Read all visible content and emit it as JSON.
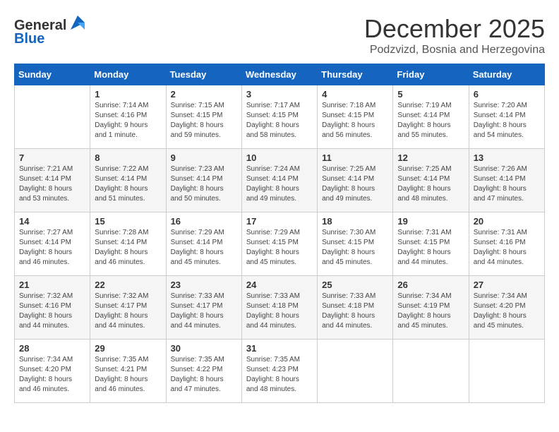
{
  "logo": {
    "general": "General",
    "blue": "Blue"
  },
  "header": {
    "month": "December 2025",
    "location": "Podzvizd, Bosnia and Herzegovina"
  },
  "weekdays": [
    "Sunday",
    "Monday",
    "Tuesday",
    "Wednesday",
    "Thursday",
    "Friday",
    "Saturday"
  ],
  "weeks": [
    [
      {
        "day": "",
        "info": ""
      },
      {
        "day": "1",
        "info": "Sunrise: 7:14 AM\nSunset: 4:16 PM\nDaylight: 9 hours\nand 1 minute."
      },
      {
        "day": "2",
        "info": "Sunrise: 7:15 AM\nSunset: 4:15 PM\nDaylight: 8 hours\nand 59 minutes."
      },
      {
        "day": "3",
        "info": "Sunrise: 7:17 AM\nSunset: 4:15 PM\nDaylight: 8 hours\nand 58 minutes."
      },
      {
        "day": "4",
        "info": "Sunrise: 7:18 AM\nSunset: 4:15 PM\nDaylight: 8 hours\nand 56 minutes."
      },
      {
        "day": "5",
        "info": "Sunrise: 7:19 AM\nSunset: 4:14 PM\nDaylight: 8 hours\nand 55 minutes."
      },
      {
        "day": "6",
        "info": "Sunrise: 7:20 AM\nSunset: 4:14 PM\nDaylight: 8 hours\nand 54 minutes."
      }
    ],
    [
      {
        "day": "7",
        "info": "Sunrise: 7:21 AM\nSunset: 4:14 PM\nDaylight: 8 hours\nand 53 minutes."
      },
      {
        "day": "8",
        "info": "Sunrise: 7:22 AM\nSunset: 4:14 PM\nDaylight: 8 hours\nand 51 minutes."
      },
      {
        "day": "9",
        "info": "Sunrise: 7:23 AM\nSunset: 4:14 PM\nDaylight: 8 hours\nand 50 minutes."
      },
      {
        "day": "10",
        "info": "Sunrise: 7:24 AM\nSunset: 4:14 PM\nDaylight: 8 hours\nand 49 minutes."
      },
      {
        "day": "11",
        "info": "Sunrise: 7:25 AM\nSunset: 4:14 PM\nDaylight: 8 hours\nand 49 minutes."
      },
      {
        "day": "12",
        "info": "Sunrise: 7:25 AM\nSunset: 4:14 PM\nDaylight: 8 hours\nand 48 minutes."
      },
      {
        "day": "13",
        "info": "Sunrise: 7:26 AM\nSunset: 4:14 PM\nDaylight: 8 hours\nand 47 minutes."
      }
    ],
    [
      {
        "day": "14",
        "info": "Sunrise: 7:27 AM\nSunset: 4:14 PM\nDaylight: 8 hours\nand 46 minutes."
      },
      {
        "day": "15",
        "info": "Sunrise: 7:28 AM\nSunset: 4:14 PM\nDaylight: 8 hours\nand 46 minutes."
      },
      {
        "day": "16",
        "info": "Sunrise: 7:29 AM\nSunset: 4:14 PM\nDaylight: 8 hours\nand 45 minutes."
      },
      {
        "day": "17",
        "info": "Sunrise: 7:29 AM\nSunset: 4:15 PM\nDaylight: 8 hours\nand 45 minutes."
      },
      {
        "day": "18",
        "info": "Sunrise: 7:30 AM\nSunset: 4:15 PM\nDaylight: 8 hours\nand 45 minutes."
      },
      {
        "day": "19",
        "info": "Sunrise: 7:31 AM\nSunset: 4:15 PM\nDaylight: 8 hours\nand 44 minutes."
      },
      {
        "day": "20",
        "info": "Sunrise: 7:31 AM\nSunset: 4:16 PM\nDaylight: 8 hours\nand 44 minutes."
      }
    ],
    [
      {
        "day": "21",
        "info": "Sunrise: 7:32 AM\nSunset: 4:16 PM\nDaylight: 8 hours\nand 44 minutes."
      },
      {
        "day": "22",
        "info": "Sunrise: 7:32 AM\nSunset: 4:17 PM\nDaylight: 8 hours\nand 44 minutes."
      },
      {
        "day": "23",
        "info": "Sunrise: 7:33 AM\nSunset: 4:17 PM\nDaylight: 8 hours\nand 44 minutes."
      },
      {
        "day": "24",
        "info": "Sunrise: 7:33 AM\nSunset: 4:18 PM\nDaylight: 8 hours\nand 44 minutes."
      },
      {
        "day": "25",
        "info": "Sunrise: 7:33 AM\nSunset: 4:18 PM\nDaylight: 8 hours\nand 44 minutes."
      },
      {
        "day": "26",
        "info": "Sunrise: 7:34 AM\nSunset: 4:19 PM\nDaylight: 8 hours\nand 45 minutes."
      },
      {
        "day": "27",
        "info": "Sunrise: 7:34 AM\nSunset: 4:20 PM\nDaylight: 8 hours\nand 45 minutes."
      }
    ],
    [
      {
        "day": "28",
        "info": "Sunrise: 7:34 AM\nSunset: 4:20 PM\nDaylight: 8 hours\nand 46 minutes."
      },
      {
        "day": "29",
        "info": "Sunrise: 7:35 AM\nSunset: 4:21 PM\nDaylight: 8 hours\nand 46 minutes."
      },
      {
        "day": "30",
        "info": "Sunrise: 7:35 AM\nSunset: 4:22 PM\nDaylight: 8 hours\nand 47 minutes."
      },
      {
        "day": "31",
        "info": "Sunrise: 7:35 AM\nSunset: 4:23 PM\nDaylight: 8 hours\nand 48 minutes."
      },
      {
        "day": "",
        "info": ""
      },
      {
        "day": "",
        "info": ""
      },
      {
        "day": "",
        "info": ""
      }
    ]
  ]
}
